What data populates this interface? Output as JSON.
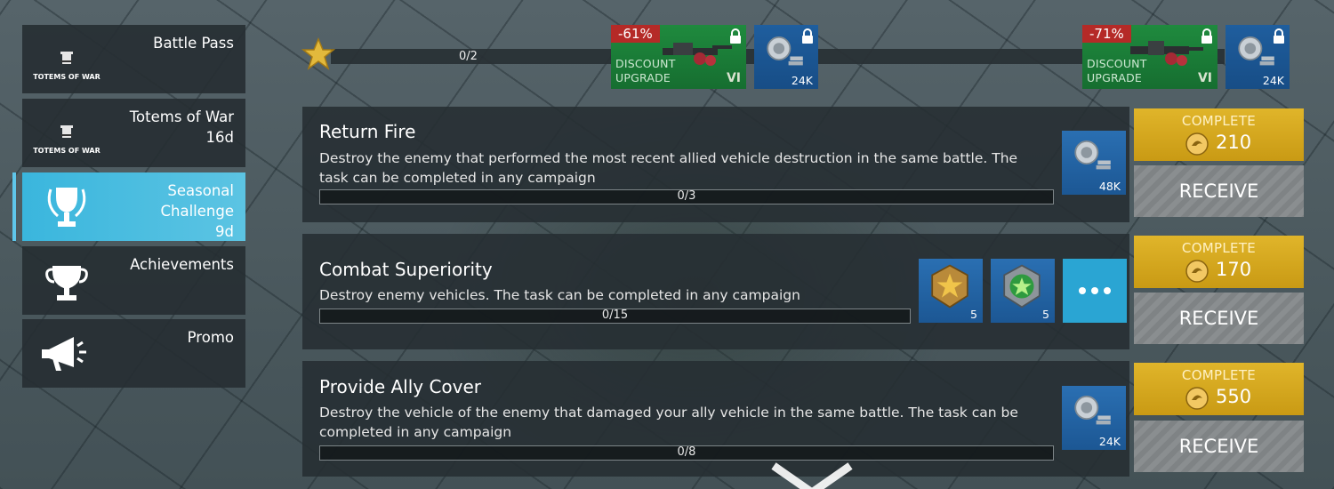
{
  "sidebar": {
    "items": [
      {
        "label": "Battle Pass",
        "sub": "",
        "icon": "totems-of-war-logo",
        "logo_text": "TOTEMS OF WAR"
      },
      {
        "label": "Totems of War",
        "sub": "16d",
        "icon": "totems-of-war-logo",
        "logo_text": "TOTEMS OF WAR"
      },
      {
        "label": "Seasonal Challenge",
        "sub": "9d",
        "icon": "trophy-wreath-icon",
        "active": true
      },
      {
        "label": "Achievements",
        "sub": "",
        "icon": "trophy-icon"
      },
      {
        "label": "Promo",
        "sub": "",
        "icon": "megaphone-icon"
      }
    ]
  },
  "star_track": {
    "progress_text": "0/2",
    "rewards": [
      {
        "type": "discount",
        "badge": "-61%",
        "line1": "DISCOUNT",
        "line2": "UPGRADE",
        "tier": "VI",
        "locked": true
      },
      {
        "type": "silver",
        "amount": "24K",
        "locked": true
      },
      {
        "type": "discount",
        "badge": "-71%",
        "line1": "DISCOUNT",
        "line2": "UPGRADE",
        "tier": "VI",
        "locked": true
      },
      {
        "type": "silver",
        "amount": "24K",
        "locked": true
      }
    ]
  },
  "tasks": [
    {
      "title": "Return Fire",
      "description": "Destroy the enemy that performed the most recent allied vehicle destruction in the same battle. The task can be completed in any campaign",
      "progress_text": "0/3",
      "progress": 0,
      "rewards": [
        {
          "icon": "silver-coins-icon",
          "amount": "48K"
        }
      ],
      "complete_label": "COMPLETE",
      "complete_value": "210",
      "receive_label": "RECEIVE"
    },
    {
      "title": "Combat Superiority",
      "description": "Destroy enemy vehicles. The task can be completed in any campaign",
      "progress_text": "0/15",
      "progress": 0,
      "rewards": [
        {
          "icon": "gold-star-medal-icon",
          "amount": "5"
        },
        {
          "icon": "green-star-medal-icon",
          "amount": "5"
        }
      ],
      "has_more": true,
      "complete_label": "COMPLETE",
      "complete_value": "170",
      "receive_label": "RECEIVE"
    },
    {
      "title": "Provide Ally Cover",
      "description": "Destroy the vehicle of the enemy that damaged your ally vehicle in the same battle. The task can be completed in any campaign",
      "progress_text": "0/8",
      "progress": 0,
      "rewards": [
        {
          "icon": "silver-coins-icon",
          "amount": "24K"
        }
      ],
      "complete_label": "COMPLETE",
      "complete_value": "550",
      "receive_label": "RECEIVE"
    }
  ],
  "colors": {
    "accent_blue": "#3ab6dd",
    "complete_gold": "#d6a91f",
    "receive_gray": "#858a8c",
    "discount_green": "#1c7f39",
    "discount_red": "#b52a27"
  }
}
